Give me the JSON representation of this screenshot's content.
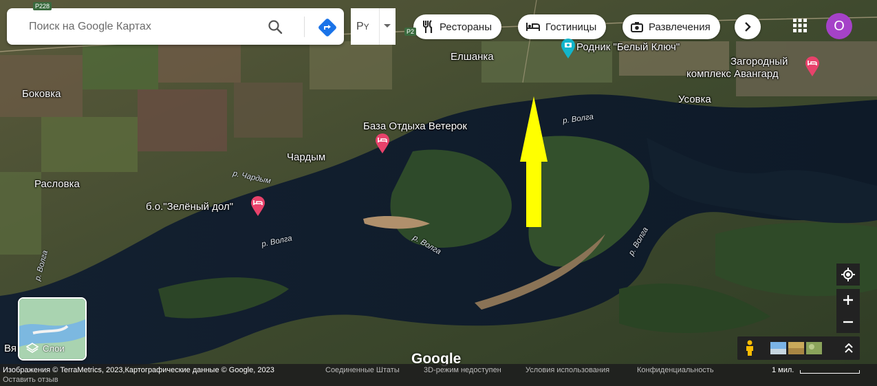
{
  "search": {
    "placeholder": "Поиск на Google Картах"
  },
  "input_tool": {
    "label": "Р",
    "sub": "Y"
  },
  "chips": [
    {
      "label": "Рестораны",
      "icon": "restaurant-icon"
    },
    {
      "label": "Гостиницы",
      "icon": "hotel-icon"
    },
    {
      "label": "Развлечения",
      "icon": "camera-icon"
    }
  ],
  "account": {
    "initial": "O"
  },
  "places": {
    "elshanka": "Елшанка",
    "rodnik": "Родник \"Белый Ключ\"",
    "kompleks_line1": "Загородный",
    "kompleks_line2": "комплекс Авангард",
    "usovka": "Усовка",
    "bokovka": "Боковка",
    "baza": "База Отдыха Ветерок",
    "chardym": "Чардым",
    "raslovka": "Расловка",
    "zeleny_dol": "б.о.\"Зелёный дол\"",
    "vya": "Вя"
  },
  "rivers": {
    "volga_1": "р. Волга",
    "volga_2": "р. Волга",
    "volga_3": "р. Волга",
    "volga_4": "р. Волга",
    "volga_5": "р. Волга",
    "chardym_river": "р. Чардым"
  },
  "roads": {
    "r228": "Р228",
    "p22": "Р2"
  },
  "layers": {
    "label": "Слои"
  },
  "logo": "Google",
  "footer": {
    "imagery": "Изображения © TerraMetrics, 2023,Картографические данные © Google, 2023",
    "country": "Соединенные Штаты",
    "mode3d": "3D-режим недоступен",
    "terms": "Условия использования",
    "privacy": "Конфиденциальность",
    "feedback": "Оставить отзыв",
    "scale": "1 мил."
  },
  "colors": {
    "accent_arrow": "#ffff00",
    "pin": "#e8426b",
    "avatar": "#a542c8"
  }
}
